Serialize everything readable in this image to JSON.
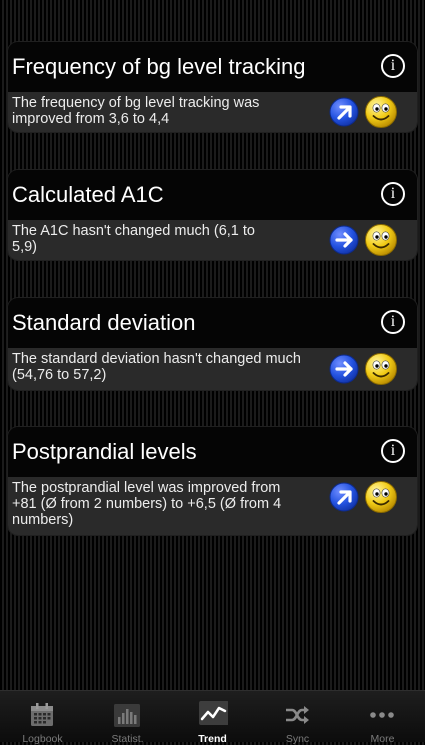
{
  "cards": [
    {
      "title": "Frequency of bg level tracking",
      "info_icon": "info-icon",
      "text": "The frequency of bg level tracking was improved from 3,6 to 4,4",
      "trend_icon": "arrow-up-right-icon",
      "trend_color": "#1f4bd8",
      "mood_icon": "smiley-icon"
    },
    {
      "title": "Calculated A1C",
      "info_icon": "info-icon",
      "text": "The A1C hasn't changed much (6,1 to 5,9)",
      "trend_icon": "arrow-right-icon",
      "trend_color": "#1f4bd8",
      "mood_icon": "smiley-icon"
    },
    {
      "title": "Standard deviation",
      "info_icon": "info-icon",
      "text": "The standard deviation hasn't changed much (54,76 to 57,2)",
      "trend_icon": "arrow-right-icon",
      "trend_color": "#1f4bd8",
      "mood_icon": "smiley-icon"
    },
    {
      "title": "Postprandial levels",
      "info_icon": "info-icon",
      "text": "The postprandial level was improved from +81  (Ø from 2 numbers) to +6,5 (Ø from 4 numbers)",
      "trend_icon": "arrow-up-right-icon",
      "trend_color": "#1f4bd8",
      "mood_icon": "smiley-icon"
    }
  ],
  "tabbar": {
    "tabs": [
      {
        "label": "Logbook",
        "icon": "calendar-icon",
        "active": false
      },
      {
        "label": "Statist.",
        "icon": "bar-chart-icon",
        "active": false
      },
      {
        "label": "Trend",
        "icon": "trend-line-icon",
        "active": true
      },
      {
        "label": "Sync",
        "icon": "shuffle-icon",
        "active": false
      },
      {
        "label": "More",
        "icon": "more-icon",
        "active": false
      }
    ]
  },
  "colors": {
    "card_header": "#050505",
    "card_body": "#2a2a2a",
    "smiley_yellow": "#f2cc17",
    "active_tab": "#ffffff",
    "inactive_tab": "#7a7a7a"
  }
}
